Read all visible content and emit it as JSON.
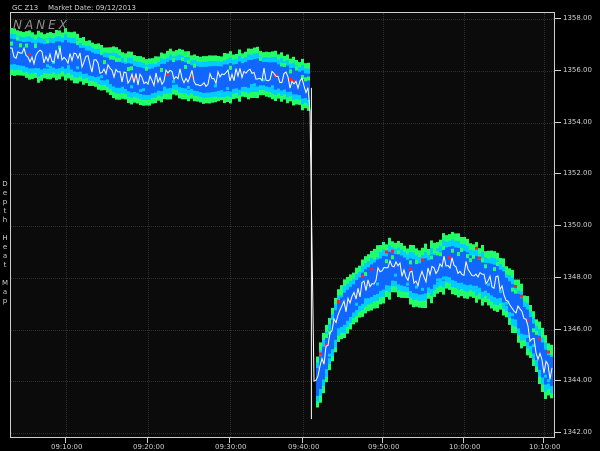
{
  "header": {
    "symbol": "GC Z13",
    "market_date": "Market Date: 09/12/2013"
  },
  "watermark": "NANEX",
  "side_title": "D\ne\np\nt\nh\n\nH\ne\na\nt\n\nM\na\np",
  "y_axis": {
    "labels": [
      "1358.00",
      "1356.00",
      "1354.00",
      "1352.00",
      "1350.00",
      "1348.00",
      "1346.00",
      "1344.00",
      "1342.00"
    ]
  },
  "x_axis": {
    "labels": [
      "09:10:00",
      "09:20:00",
      "09:30:00",
      "09:40:00",
      "09:50:00",
      "10:00:00",
      "10:10:00"
    ]
  },
  "colors": {
    "background": "#000000",
    "plot_background": "#0b0b0b",
    "heat_low": "#1166ff",
    "heat_mid": "#00ccff",
    "heat_high": "#22ff66",
    "heat_peak": "#ff2020",
    "price_line": "#ffffff"
  },
  "chart_data": {
    "type": "heatmap",
    "ylim": [
      1342,
      1358
    ],
    "price_path": [
      [
        0,
        1356.7
      ],
      [
        0.05,
        1356.5
      ],
      [
        0.1,
        1356.6
      ],
      [
        0.15,
        1356.2
      ],
      [
        0.2,
        1355.8
      ],
      [
        0.25,
        1355.5
      ],
      [
        0.3,
        1355.9
      ],
      [
        0.35,
        1355.6
      ],
      [
        0.4,
        1355.7
      ],
      [
        0.45,
        1355.9
      ],
      [
        0.5,
        1355.7
      ],
      [
        0.55,
        1355.3
      ],
      [
        0.555,
        1343.5
      ],
      [
        0.57,
        1344.5
      ],
      [
        0.6,
        1346.5
      ],
      [
        0.65,
        1347.7
      ],
      [
        0.7,
        1348.4
      ],
      [
        0.75,
        1347.9
      ],
      [
        0.8,
        1348.6
      ],
      [
        0.85,
        1348.2
      ],
      [
        0.9,
        1347.7
      ],
      [
        0.95,
        1346.0
      ],
      [
        0.98,
        1344.5
      ],
      [
        1.0,
        1344.2
      ]
    ]
  }
}
